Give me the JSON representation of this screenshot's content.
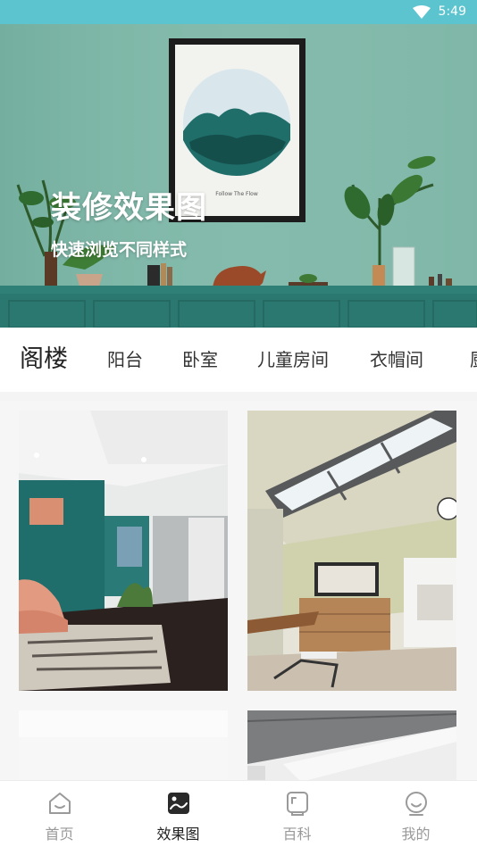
{
  "status_bar": {
    "time": "5:49"
  },
  "hero": {
    "title": "装修效果图",
    "subtitle": "快速浏览不同样式",
    "poster_caption": "Follow The Flow"
  },
  "tabs": [
    {
      "label": "阁楼",
      "active": true
    },
    {
      "label": "阳台",
      "active": false
    },
    {
      "label": "卧室",
      "active": false
    },
    {
      "label": "儿童房间",
      "active": false
    },
    {
      "label": "衣帽间",
      "active": false
    },
    {
      "label": "厨",
      "active": false
    }
  ],
  "bottom_nav": [
    {
      "label": "首页",
      "icon": "home-icon",
      "active": false
    },
    {
      "label": "效果图",
      "icon": "gallery-icon",
      "active": true
    },
    {
      "label": "百科",
      "icon": "encyclopedia-icon",
      "active": false
    },
    {
      "label": "我的",
      "icon": "profile-icon",
      "active": false
    }
  ],
  "colors": {
    "status_bar": "#5cc4cf",
    "accent_teal": "#2f7f78",
    "text_primary": "#222222",
    "text_muted": "#999999"
  }
}
